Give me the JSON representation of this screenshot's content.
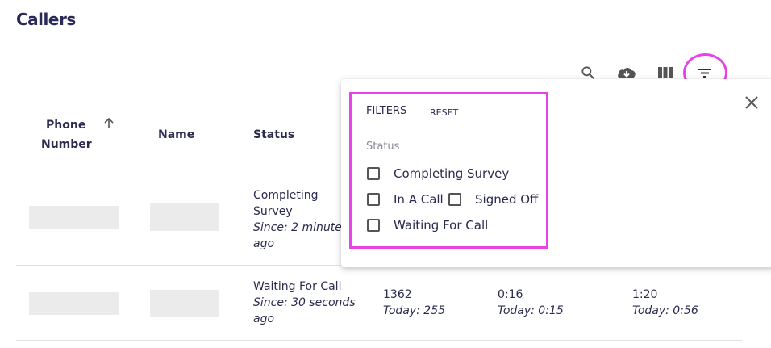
{
  "page": {
    "title": "Callers"
  },
  "toolbar": {
    "icons": [
      "search-icon",
      "cloud-download-icon",
      "view-column-icon",
      "filter-list-icon"
    ]
  },
  "table": {
    "headers": [
      "Phone Number",
      "Name",
      "Status"
    ],
    "header_lines": {
      "phone_line1": "Phone",
      "phone_line2": "Number"
    },
    "rows": [
      {
        "status": "Completing Survey",
        "status_line1": "Completing",
        "status_line2": "Survey",
        "since_line1": "Since: 2 minutes",
        "since_line2": "ago"
      },
      {
        "status": "Waiting For Call",
        "since_line1": "Since: 30 seconds",
        "since_line2": "ago",
        "col4_main": "1362",
        "col4_sub": "Today: 255",
        "col5_main": "0:16",
        "col5_sub": "Today: 0:15",
        "col6_main": "1:20",
        "col6_sub": "Today: 0:56"
      }
    ]
  },
  "filter_panel": {
    "title": "FILTERS",
    "reset_label": "RESET",
    "status_label": "Status",
    "options": [
      {
        "label": "Completing Survey",
        "checked": false
      },
      {
        "label": "In A Call",
        "checked": false
      },
      {
        "label": "Signed Off",
        "checked": false
      },
      {
        "label": "Waiting For Call",
        "checked": false
      }
    ]
  },
  "colors": {
    "highlight": "#e843e8",
    "text": "#2b2b4f",
    "placeholder": "#ebebeb"
  }
}
